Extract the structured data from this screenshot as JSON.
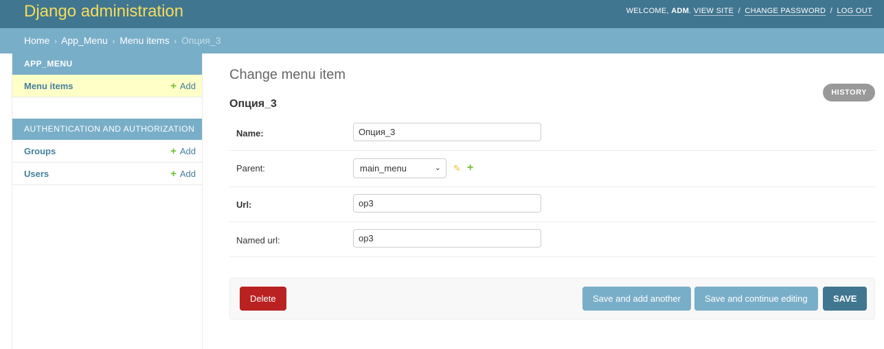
{
  "header": {
    "branding": "Django administration",
    "welcome": "WELCOME,",
    "username": "ADM",
    "links": {
      "view_site": "VIEW SITE",
      "change_password": "CHANGE PASSWORD",
      "log_out": "LOG OUT"
    },
    "separator": "/"
  },
  "breadcrumbs": {
    "items": [
      "Home",
      "App_Menu",
      "Menu items"
    ],
    "current": "Опция_3",
    "arrow": "›"
  },
  "sidebar": {
    "modules": [
      {
        "caption": "APP_MENU",
        "models": [
          {
            "name": "Menu items",
            "add": "Add"
          }
        ]
      },
      {
        "caption": "AUTHENTICATION AND AUTHORIZATION",
        "models": [
          {
            "name": "Groups",
            "add": "Add"
          },
          {
            "name": "Users",
            "add": "Add"
          }
        ]
      }
    ]
  },
  "content": {
    "title": "Change menu item",
    "history": "HISTORY",
    "object_title": "Опция_3",
    "fields": {
      "name": {
        "label": "Name:",
        "value": "Опция_3"
      },
      "parent": {
        "label": "Parent:",
        "value": "main_menu"
      },
      "url": {
        "label": "Url:",
        "value": "op3"
      },
      "named_url": {
        "label": "Named url:",
        "value": "op3"
      }
    },
    "buttons": {
      "delete": "Delete",
      "save_add_another": "Save and add another",
      "save_continue": "Save and continue editing",
      "save": "SAVE"
    }
  },
  "colors": {
    "header_bg": "#417690",
    "branding": "#f5dd5d",
    "breadcrumbs_bg": "#79aec8",
    "active_row": "#ffffc8",
    "delete": "#ba2121",
    "add_green": "#70bf2b"
  },
  "icons": {
    "breadcrumb_separator": "›",
    "add": "plus-icon",
    "change": "pencil-icon",
    "select_caret": "chevron-down-icon"
  }
}
